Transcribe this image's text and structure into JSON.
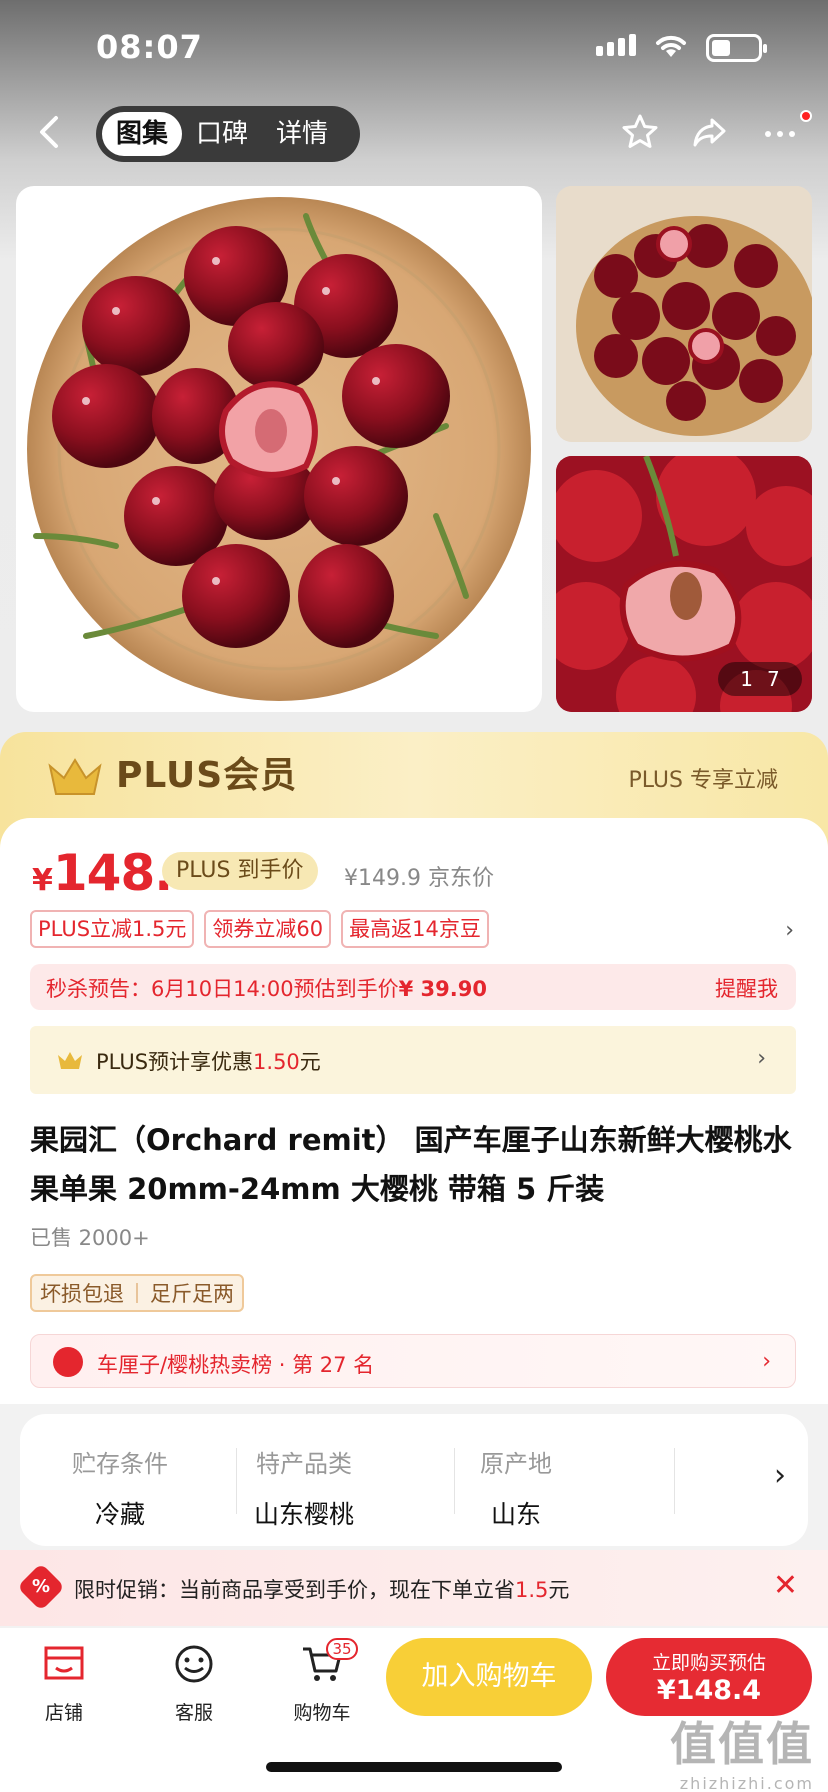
{
  "status": {
    "time": "08:07"
  },
  "nav": {
    "tabs": [
      {
        "label": "图集",
        "active": true
      },
      {
        "label": "口碑",
        "active": false
      },
      {
        "label": "详情",
        "active": false
      }
    ]
  },
  "gallery": {
    "current": "1",
    "total": "7"
  },
  "plus_banner": {
    "title": "PLUS会员",
    "right": "PLUS 专享立减"
  },
  "price": {
    "currency": "¥",
    "integer": "148.",
    "decimal": "4",
    "plus_tag": "PLUS 到手价",
    "original": "¥149.9 京东价"
  },
  "tags": [
    "PLUS立减1.5元",
    "领券立减60",
    "最高返14京豆"
  ],
  "flash": {
    "label": "秒杀预告：",
    "time": "6月10日14:00",
    "text": "预估到手价",
    "price": "¥ 39.90",
    "remind": "提醒我"
  },
  "plus_pre": {
    "text": "PLUS预计享优惠",
    "amount": "1.50",
    "unit": "元"
  },
  "product": {
    "title": "果园汇（Orchard remit） 国产车厘子山东新鲜大樱桃水果单果 20mm-24mm 大樱桃 带箱 5 斤装",
    "sold": "已售 2000+",
    "services": [
      "坏损包退",
      "足斤足两"
    ],
    "rank": "车厘子/樱桃热卖榜 · 第 27 名"
  },
  "specs": [
    {
      "key": "贮存条件",
      "value": "冷藏"
    },
    {
      "key": "特产品类",
      "value": "山东樱桃"
    },
    {
      "key": "原产地",
      "value": "山东"
    }
  ],
  "promo": {
    "icon_text": "%",
    "text": "限时促销：当前商品享受到手价，现在下单立省",
    "amount": "1.5",
    "unit": "元"
  },
  "bottom": {
    "store": "店铺",
    "service": "客服",
    "cart": "购物车",
    "cart_count": "35",
    "add_cart": "加入购物车",
    "buy_line1": "立即购买预估",
    "buy_line2": "¥148.4"
  },
  "watermark": {
    "big": "值值值",
    "small": "zhizhizhi.com"
  },
  "colors": {
    "accent": "#e4262e",
    "gold": "#f8cf37",
    "plus": "#6b4b1a"
  },
  "icons": [
    "back-icon",
    "star-icon",
    "share-icon",
    "more-icon",
    "crown-icon",
    "rank-icon",
    "promo-icon",
    "close-icon",
    "store-icon",
    "service-icon",
    "cart-icon"
  ]
}
